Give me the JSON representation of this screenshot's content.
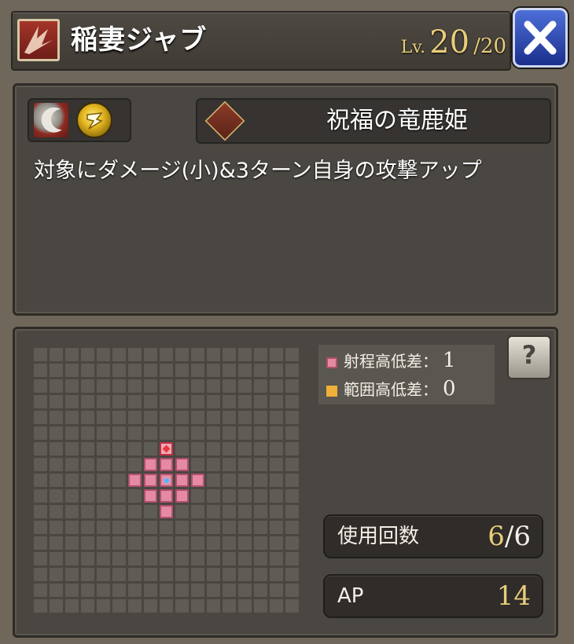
{
  "skill": {
    "name": "稲妻ジャブ",
    "level_label": "Lv.",
    "level_current": "20",
    "level_max": "/20"
  },
  "character": {
    "name": "祝福の竜鹿姫"
  },
  "description": "対象にダメージ(小)&3ターン自身の攻撃アップ",
  "legend": {
    "range_height_label": "射程高低差：",
    "range_height_value": "1",
    "area_height_label": "範囲高低差：",
    "area_height_value": "0",
    "range_color": "#e48aa3",
    "area_color": "#f0b13a"
  },
  "stats": {
    "uses_label": "使用回数",
    "uses_current": "6",
    "uses_max": "/6",
    "ap_label": "AP",
    "ap_value": "14"
  },
  "help_glyph": "?",
  "close_glyph": "✕",
  "grid": {
    "cols": 17,
    "rows": 17,
    "self_cell": [
      8,
      8
    ],
    "target_cells": [
      [
        8,
        6
      ]
    ],
    "range_cells": [
      [
        7,
        7
      ],
      [
        8,
        7
      ],
      [
        9,
        7
      ],
      [
        6,
        8
      ],
      [
        7,
        8
      ],
      [
        9,
        8
      ],
      [
        10,
        8
      ],
      [
        7,
        9
      ],
      [
        8,
        9
      ],
      [
        9,
        9
      ],
      [
        8,
        10
      ],
      [
        8,
        8
      ]
    ]
  },
  "colors": {
    "accent_gold": "#e8cd7a",
    "close_blue": "#2a44b8",
    "panel": "#4a4641"
  }
}
